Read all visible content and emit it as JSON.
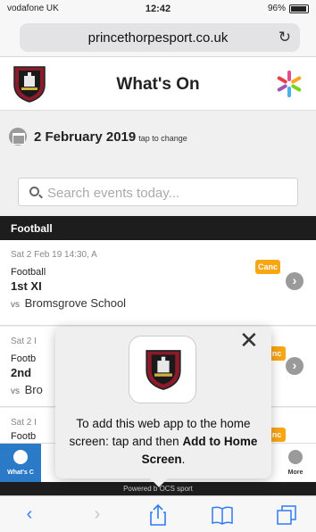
{
  "status": {
    "carrier": "vodafone UK",
    "time": "12:42",
    "battery": "96%"
  },
  "browser": {
    "url": "princethorpesport.co.uk"
  },
  "header": {
    "title": "What's On"
  },
  "date_selector": {
    "date": "2 February 2019",
    "hint": "tap to change"
  },
  "search": {
    "placeholder": "Search events today..."
  },
  "section": {
    "title": "Football"
  },
  "events": [
    {
      "when": "Sat 2 Feb 19 14:30, A",
      "sport": "Football",
      "team": "1st XI",
      "vs": "vs",
      "opponent": "Bromsgrove School",
      "badge": "Canc"
    },
    {
      "when": "Sat 2 I",
      "sport": "Footb",
      "team": "2nd",
      "vs": "vs",
      "opponent": "Bro",
      "badge": "nc"
    },
    {
      "when": "Sat 2 I",
      "sport": "Footb",
      "team": "",
      "vs": "",
      "opponent": "",
      "badge": "nc"
    }
  ],
  "tabs": {
    "active_label": "What's C",
    "more_label": "More"
  },
  "footer": {
    "powered": "Powered b  OCS sport"
  },
  "popup": {
    "msg_part1": "To add this web app to the home screen: tap",
    "msg_part2": "and then",
    "msg_bold": "Add to Home Screen",
    "msg_end": "."
  },
  "colors": {
    "accent": "#2a7ac8",
    "badge": "#f7a614",
    "dark_bar": "#1d1d1d",
    "safari_blue": "#2f7cf6"
  }
}
